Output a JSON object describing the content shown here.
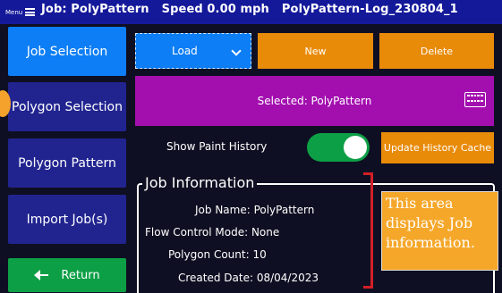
{
  "header": {
    "menu_label": "Menu",
    "job_title": "Job: PolyPattern",
    "speed": "Speed 0.00 mph",
    "log_name": "PolyPattern-Log_230804_1"
  },
  "nav": {
    "job_selection": "Job Selection",
    "polygon_selection": "Polygon Selection",
    "polygon_pattern": "Polygon Pattern",
    "import_jobs": "Import Job(s)",
    "return": "Return"
  },
  "toolbar": {
    "load_value": "Load",
    "new_label": "New",
    "delete_label": "Delete"
  },
  "selected": {
    "text": "Selected: PolyPattern"
  },
  "history": {
    "label": "Show Paint History",
    "toggle_on": true,
    "update_label": "Update History Cache"
  },
  "job_info": {
    "title": "Job Information",
    "name": "Job Name: PolyPattern",
    "flow_mode": "Flow Control Mode: None",
    "polygon_count": "Polygon Count: 10",
    "created_date": "Created Date: 08/04/2023"
  },
  "annotation": {
    "lines": [
      "This area",
      "displays Job",
      "information."
    ]
  },
  "colors": {
    "header_bg": "#14199a",
    "primary_blue": "#0d7ef5",
    "nav_dark": "#21248f",
    "green": "#0d9f46",
    "orange": "#e88b09",
    "purple": "#a30eaf",
    "annotation_red": "#d21f26",
    "annotation_orange": "#f5a72a"
  },
  "icons": {
    "menu": "hamburger-icon",
    "keyboard": "keyboard-icon",
    "return": "arrow-left-icon",
    "dropdown": "chevron-down-icon"
  }
}
